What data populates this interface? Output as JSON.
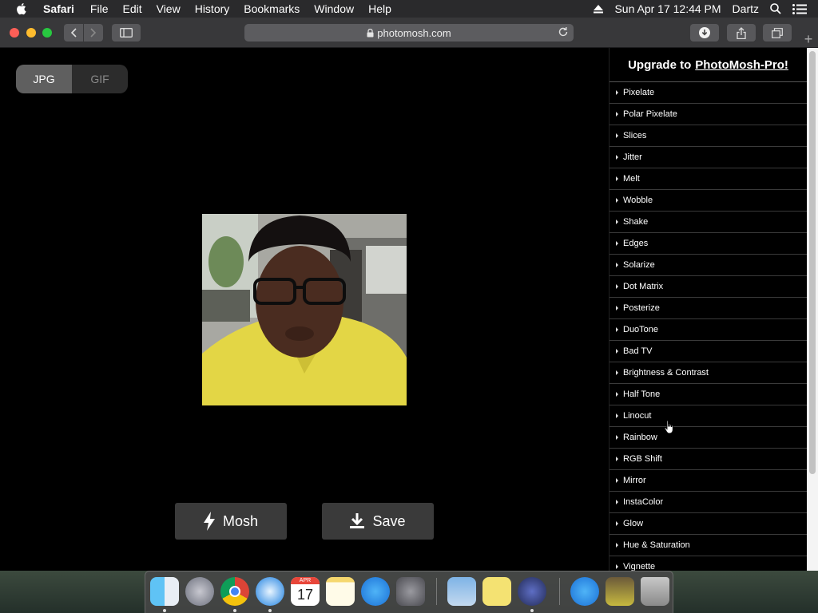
{
  "menubar": {
    "app_name": "Safari",
    "items": [
      "File",
      "Edit",
      "View",
      "History",
      "Bookmarks",
      "Window",
      "Help"
    ],
    "datetime": "Sun Apr 17  12:44 PM",
    "user": "Dartz"
  },
  "toolbar": {
    "url": "photomosh.com"
  },
  "page": {
    "format_options": [
      "JPG",
      "GIF"
    ],
    "selected_format": "JPG",
    "mosh_label": "Mosh",
    "save_label": "Save"
  },
  "sidebar": {
    "upgrade_prefix": "Upgrade to",
    "upgrade_link": "PhotoMosh-Pro!",
    "effects": [
      "Pixelate",
      "Polar Pixelate",
      "Slices",
      "Jitter",
      "Melt",
      "Wobble",
      "Shake",
      "Edges",
      "Solarize",
      "Dot Matrix",
      "Posterize",
      "DuoTone",
      "Bad TV",
      "Brightness & Contrast",
      "Half Tone",
      "Linocut",
      "Rainbow",
      "RGB Shift",
      "Mirror",
      "InstaColor",
      "Glow",
      "Hue & Saturation",
      "Vignette"
    ]
  },
  "dock": {
    "calendar_month": "APR",
    "calendar_day": "17",
    "apps": [
      "finder",
      "launchpad",
      "chrome",
      "safari",
      "calendar",
      "notes",
      "app-store",
      "system-preferences",
      "preview",
      "stickies",
      "quicktime",
      "app-store-downloads",
      "photo-file",
      "trash"
    ]
  }
}
